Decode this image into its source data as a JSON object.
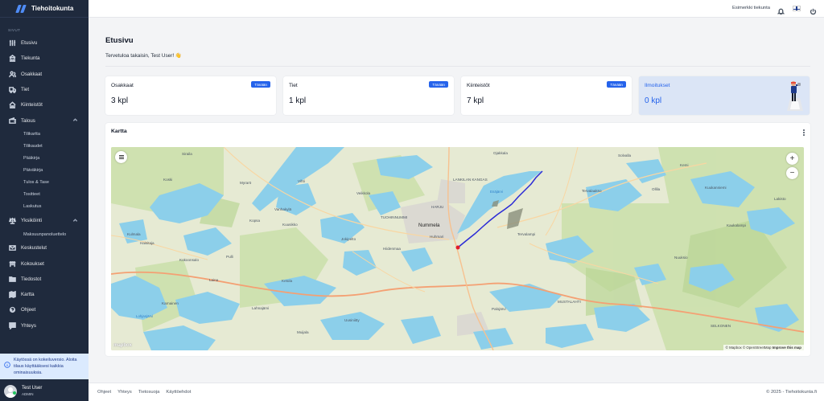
{
  "app": {
    "name": "Tiehoitokunta"
  },
  "sidebar": {
    "section_label": "SIVUT",
    "items": [
      {
        "label": "Etusivu",
        "icon": "sliders-icon"
      },
      {
        "label": "Tiekunta",
        "icon": "building-icon"
      },
      {
        "label": "Osakkaat",
        "icon": "users-icon"
      },
      {
        "label": "Tiet",
        "icon": "truck-icon"
      },
      {
        "label": "Kiinteistöt",
        "icon": "home-icon"
      },
      {
        "label": "Talous",
        "icon": "wallet-icon",
        "expanded": true,
        "children": [
          "Tilikartta",
          "Tilikaudet",
          "Pääkirja",
          "Päiväkirja",
          "Tulos & Tase",
          "Tositteet",
          "Laskutus"
        ]
      },
      {
        "label": "Yksiköinti",
        "icon": "scale-icon",
        "expanded": true,
        "children": [
          "Maksuunpanoluettelo"
        ]
      },
      {
        "label": "Keskustelut",
        "icon": "mail-icon"
      },
      {
        "label": "Kokoukset",
        "icon": "meeting-icon"
      },
      {
        "label": "Tiedostot",
        "icon": "folder-icon"
      },
      {
        "label": "Kartta",
        "icon": "map-icon"
      },
      {
        "label": "Ohjeet",
        "icon": "help-icon"
      },
      {
        "label": "Yhteys",
        "icon": "chat-icon"
      }
    ],
    "trial_notice": "Käytössä on kokeiluversio. Aloita tilaus käyttääksesi kaikkia ominaisuuksia.",
    "user": {
      "name": "Test User",
      "role": "ADMIN"
    }
  },
  "topbar": {
    "association": "Esimerkki tiekunta",
    "bell_icon": "bell-icon",
    "flag_icon": "finland-flag-icon",
    "power_icon": "power-icon"
  },
  "main": {
    "title": "Etusivu",
    "welcome": "Tervetuloa takaisin, Test User! 👋",
    "cards": [
      {
        "title": "Osakkaat",
        "value": "3 kpl",
        "badge": "Tänään"
      },
      {
        "title": "Tiet",
        "value": "1 kpl",
        "badge": "Tänään"
      },
      {
        "title": "Kiinteistöt",
        "value": "7 kpl",
        "badge": "Tänään"
      },
      {
        "title": "Ilmoitukset",
        "value": "0 kpl"
      }
    ],
    "map_panel": {
      "title": "Kartta",
      "zoom_in": "+",
      "zoom_out": "−",
      "logo": "mapbox",
      "attribution": {
        "mapbox": "© Mapbox",
        "osm": "© OpenStreetMap",
        "improve": "Improve this map"
      },
      "places": {
        "nummela": "Nummela",
        "ojakkala": "Ojakkala",
        "enajarvi": "Enäjärvi",
        "siuntio": "Siuntio",
        "vihti": "Vihti",
        "sarala": "Siraila",
        "koski": "Koski",
        "myrero": "Myrarö",
        "haisitaja": "Haisitaja",
        "pulli": "Pulli",
        "lohjanjarvi": "Lohjanjärvi",
        "karnainen": "Karnainen",
        "muijala": "Muijala",
        "uusiniitty": "Uusiniitty",
        "jokipelto": "Jokipelto",
        "hiidenmaa": "Hiidenmaa",
        "huhmari": "Huhmari",
        "veikkola": "Veikkola",
        "tervalampi": "Tervalampi",
        "palojarvi": "Palojärvi",
        "ollila": "Ollila",
        "kuukanniemi": "Kuukanniemi",
        "tervalaakso": "Tervalaakso",
        "kemi": "Kemi",
        "lakisto": "Lakisto",
        "nuuksio": "Nuuksio",
        "kaukalampi": "Kaukalampi",
        "solvalla": "Solvalla",
        "kulmala": "Kulmala",
        "kokoonsalo": "Kokoonsalo",
        "vanhakyla": "Vanhakylä",
        "kopsa": "Kopsa",
        "kuusikko": "Kuusikko",
        "ketola": "Ketola",
        "laina": "Laina",
        "lahnajarvi": "Lahnajärvi",
        "kiikala": "Kiikala",
        "tuohinnummi": "TUOHINNUMMI",
        "harju": "HARJU",
        "lankila": "LANKILAN KANGAS",
        "mustalahti": "MUSTALAHTI",
        "selkonen": "SELKONEN"
      }
    }
  },
  "footer": {
    "links": [
      "Ohjeet",
      "Yhteys",
      "Tietosuoja",
      "Käyttöehdot"
    ],
    "copyright": "© 2025 - Tiehoitokunta.fi"
  },
  "colors": {
    "sidebar_bg": "#1f2a3d",
    "accent": "#2563eb",
    "trial_bg": "#dbeafe",
    "route": "#2b2bd6",
    "marker": "#e11d2a"
  }
}
